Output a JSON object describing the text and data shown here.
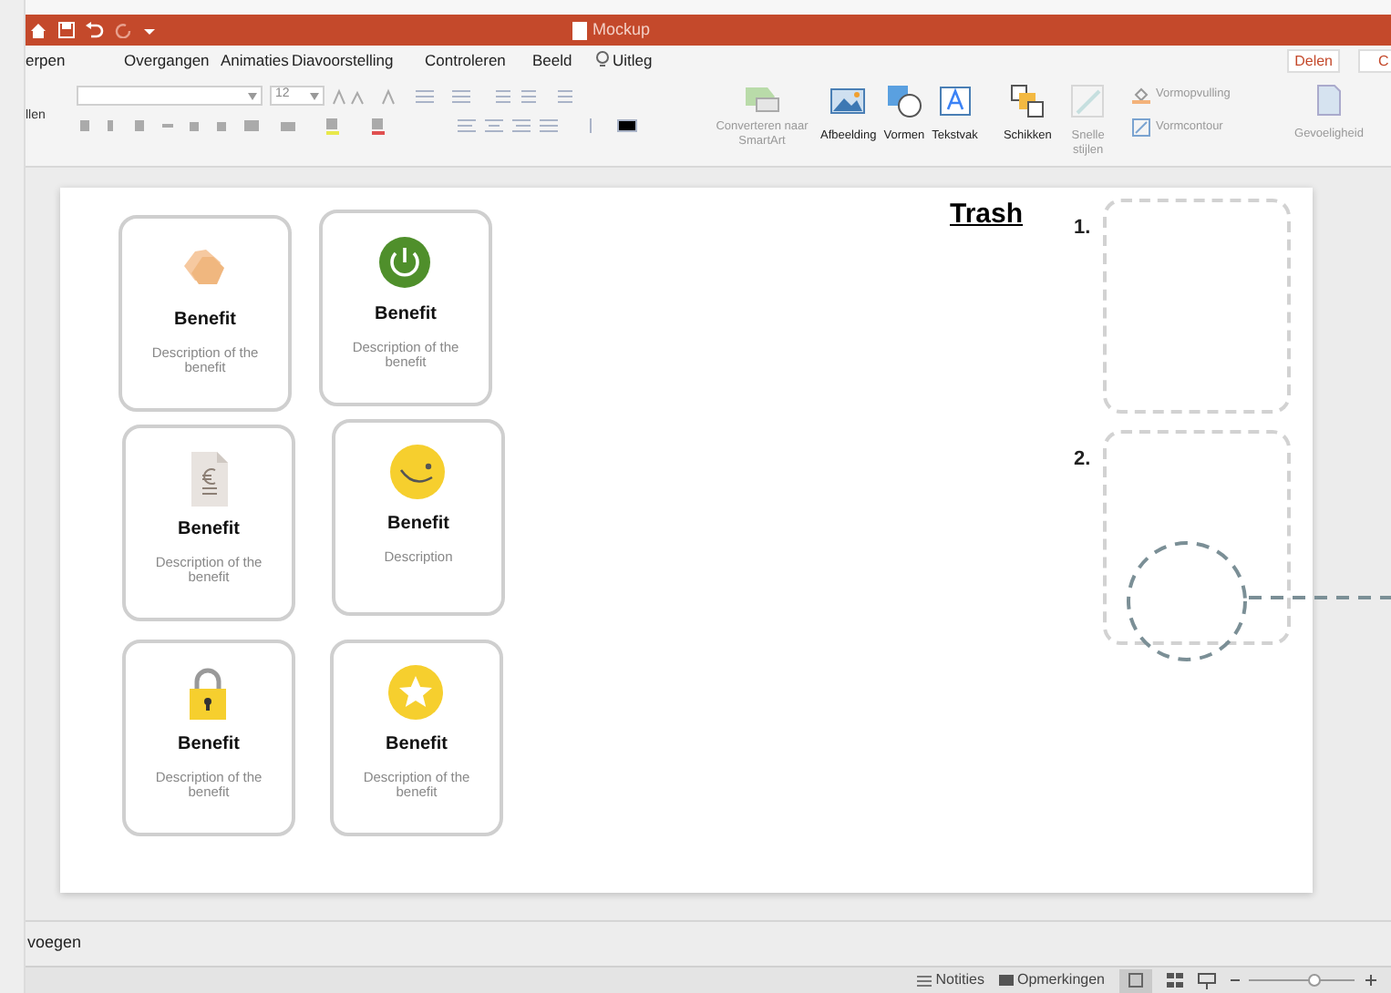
{
  "title_bar": {
    "document_title": "Mockup"
  },
  "ribbon_tabs": [
    "erpen",
    "Overgangen",
    "Animaties",
    "Diavoorstelling",
    "Controleren",
    "Beeld",
    "Uitleg"
  ],
  "header_buttons": {
    "share": "Delen",
    "comments": "C"
  },
  "ribbon": {
    "left_label": "llen",
    "font_size": "12",
    "smartart": {
      "label": "Converteren naar SmartArt",
      "disabled": true
    },
    "insert_tools": [
      {
        "kind": "picture",
        "label": "Afbeelding",
        "disabled": false
      },
      {
        "kind": "shapes",
        "label": "Vormen",
        "disabled": false
      },
      {
        "kind": "textbox",
        "label": "Tekstvak",
        "disabled": false
      },
      {
        "kind": "arrange",
        "label": "Schikken",
        "disabled": false
      },
      {
        "kind": "styles",
        "label": "Snelle stijlen",
        "disabled": true
      }
    ],
    "shape_format": [
      {
        "kind": "fill",
        "label": "Vormopvulling",
        "disabled": true
      },
      {
        "kind": "outline",
        "label": "Vormcontour",
        "disabled": true
      }
    ],
    "sensitivity": {
      "label": "Gevoeligheid",
      "disabled": true
    }
  },
  "slide": {
    "cards": [
      {
        "title": "Benefit",
        "description": "Description of the benefit"
      },
      {
        "title": "Benefit",
        "description": "Description of the benefit"
      },
      {
        "title": "Benefit",
        "description": "Description of the benefit"
      },
      {
        "title": "Benefit",
        "description": "Description"
      },
      {
        "title": "Benefit",
        "description": "Description of the benefit"
      },
      {
        "title": "Benefit",
        "description": "Description of the benefit"
      }
    ],
    "trash_title": "Trash",
    "slots": [
      {
        "number": "1."
      },
      {
        "number": "2."
      }
    ]
  },
  "notes": "voegen",
  "status_bar": {
    "notes": "Notities",
    "comments": "Opmerkingen"
  }
}
